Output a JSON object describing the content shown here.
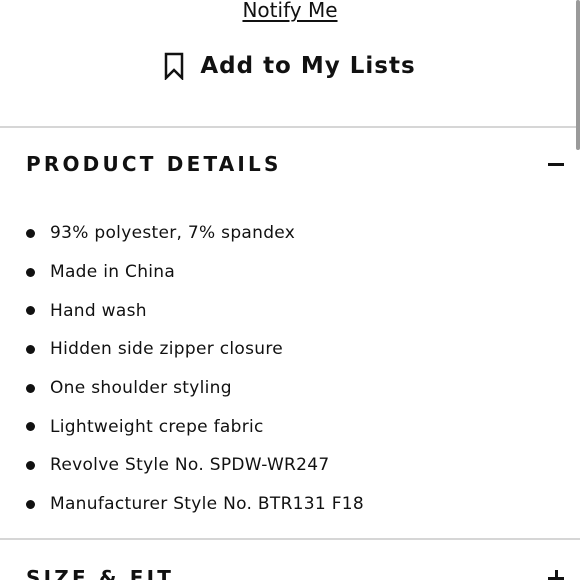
{
  "actions": {
    "notify_label": "Notify Me",
    "add_to_lists_label": "Add to My Lists"
  },
  "product_details": {
    "title": "PRODUCT DETAILS",
    "items": [
      "93% polyester, 7% spandex",
      "Made in China",
      "Hand wash",
      "Hidden side zipper closure",
      "One shoulder styling",
      "Lightweight crepe fabric",
      "Revolve Style No. SPDW-WR247",
      "Manufacturer Style No. BTR131 F18"
    ]
  },
  "next_section": {
    "title": "SIZE & FIT"
  },
  "icons": {
    "bookmark": "bookmark-icon",
    "collapse": "minus-icon",
    "expand": "plus-icon"
  }
}
